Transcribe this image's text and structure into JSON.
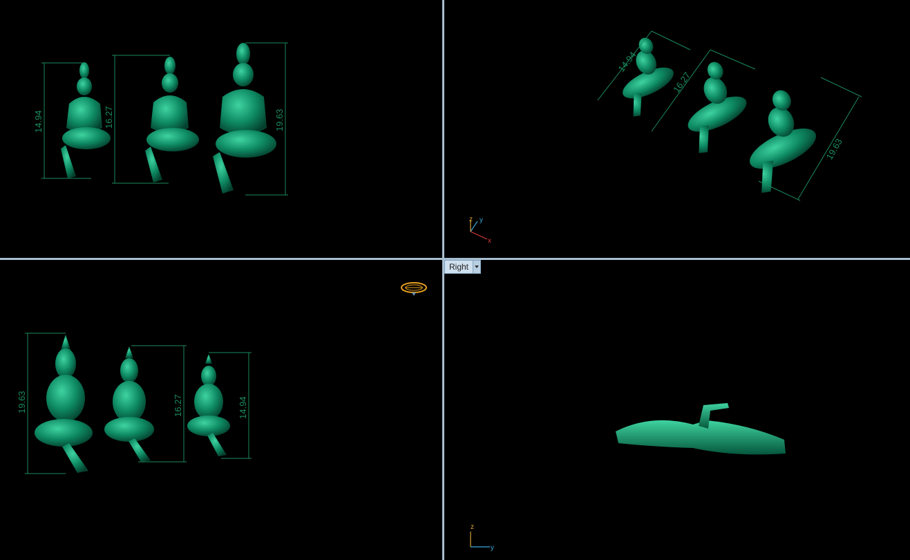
{
  "viewports": {
    "top_left": {
      "dimensions": [
        "14.94",
        "16.27",
        "19.63"
      ]
    },
    "top_right": {
      "dimensions": [
        "14.94",
        "16.27",
        "19.63"
      ],
      "axes": {
        "z": "z",
        "y": "y",
        "x": "x"
      }
    },
    "bottom_left": {
      "dimensions": [
        "19.63",
        "16.27",
        "14.94"
      ]
    },
    "bottom_right": {
      "tab_label": "Right",
      "axes": {
        "z": "z",
        "y": "y"
      }
    }
  },
  "colors": {
    "model": "#0e8a63",
    "dimension": "#1b8a5e",
    "divider": "#a9bfd0",
    "axis_x": "#d93a3a",
    "axis_y": "#3aa6d9",
    "axis_z": "#d9a23a",
    "gumball": "#e6a020"
  },
  "icons": [
    "gumball-icon",
    "axis-triad-icon",
    "dropdown-arrow-icon"
  ]
}
